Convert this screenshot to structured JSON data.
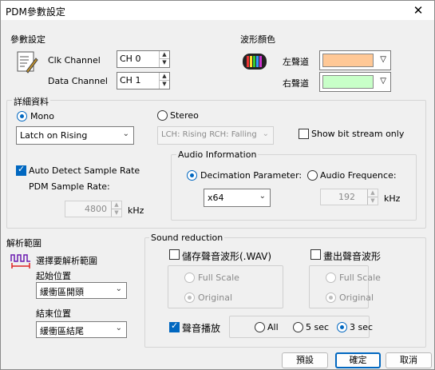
{
  "title": "PDM參數設定",
  "params": {
    "heading": "參數設定",
    "clk_label": "Clk Channel",
    "clk_value": "CH 0",
    "data_label": "Data Channel",
    "data_value": "CH 1"
  },
  "wave_color": {
    "heading": "波形顏色",
    "left_label": "左聲道",
    "left_color": "#ffc896",
    "right_label": "右聲道",
    "right_color": "#c8ffc8"
  },
  "detail": {
    "heading": "詳細資料",
    "mono_label": "Mono",
    "stereo_label": "Stereo",
    "mono_select": "Latch on Rising",
    "stereo_select": "LCH: Rising RCH: Falling",
    "show_bitstream": "Show bit stream only",
    "auto_detect": "Auto Detect Sample Rate",
    "pdm_rate_label": "PDM Sample Rate:",
    "pdm_rate_value": "4800",
    "pdm_rate_unit": "kHz",
    "audio_info": {
      "heading": "Audio Information",
      "decimation_label": "Decimation Parameter:",
      "decimation_value": "x64",
      "freq_label": "Audio Frequence:",
      "freq_value": "192",
      "freq_unit": "kHz"
    }
  },
  "range": {
    "heading": "解析範圍",
    "select_label": "選擇要解析範圍",
    "start_label": "起始位置",
    "start_value": "緩衝區開頭",
    "end_label": "結束位置",
    "end_value": "緩衝區結尾"
  },
  "sound": {
    "heading": "Sound reduction",
    "save_wav": "儲存聲音波形(.WAV)",
    "draw_wave": "畫出聲音波形",
    "full_scale": "Full Scale",
    "original": "Original",
    "play_sound": "聲音播放",
    "opt_all": "All",
    "opt_5": "5 sec",
    "opt_3": "3 sec"
  },
  "buttons": {
    "default": "預設",
    "ok": "確定",
    "cancel": "取消"
  }
}
